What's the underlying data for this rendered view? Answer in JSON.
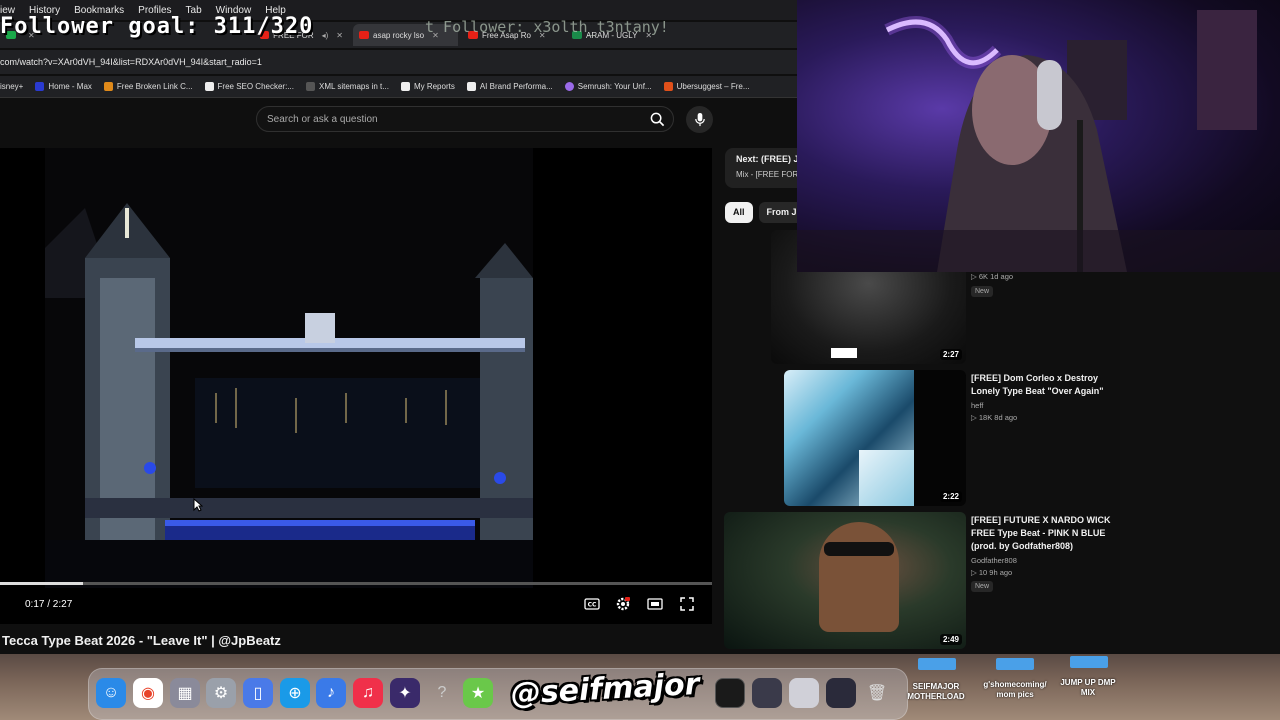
{
  "overlay": {
    "follower_goal": "Follower goal: 311/320",
    "ticker": "t Follower: x3olth_t3ntany!"
  },
  "menubar": {
    "items": [
      "iew",
      "History",
      "Bookmarks",
      "Profiles",
      "Tab",
      "Window",
      "Help"
    ]
  },
  "tabs": [
    {
      "label": "",
      "icon": "youtube-icon",
      "active": false
    },
    {
      "label": "FREE FOR",
      "icon": "youtube-icon",
      "active": false
    },
    {
      "label": "asap rocky lso",
      "icon": "youtube-icon",
      "active": true
    },
    {
      "label": "Free Asap Ro",
      "icon": "youtube-icon",
      "active": false
    },
    {
      "label": "ARAM - UGLY",
      "icon": "game-icon",
      "active": false
    }
  ],
  "browser": {
    "url": "com/watch?v=XAr0dVH_94I&list=RDXAr0dVH_94I&start_radio=1"
  },
  "bookmarks": [
    {
      "label": "isney+",
      "color": "#1a3aa0"
    },
    {
      "label": "Home - Max",
      "color": "#2a3ad0"
    },
    {
      "label": "Free Broken Link C...",
      "color": "#e08a1a"
    },
    {
      "label": "Free SEO Checker:...",
      "color": "#eeeeee"
    },
    {
      "label": "XML sitemaps in t...",
      "color": "#4a4a4a"
    },
    {
      "label": "My Reports",
      "color": "#eeeeee"
    },
    {
      "label": "AI Brand Performa...",
      "color": "#eeeeee"
    },
    {
      "label": "Semrush: Your Unf...",
      "color": "#9a6ae8"
    },
    {
      "label": "Ubersuggest – Fre...",
      "color": "#e0501a"
    }
  ],
  "search": {
    "placeholder": "Search or ask a question"
  },
  "player": {
    "time": "0:17 / 2:27",
    "progress": 0.116,
    "title": "Tecca Type Beat 2026 - \"Leave It\" | @JpBeatz"
  },
  "up_next": {
    "title": "Next: (FREE) J",
    "subtitle": "Mix - [FREE FOR"
  },
  "chips": [
    "All",
    "From Jp"
  ],
  "recommendations": [
    {
      "title": "",
      "channel": "",
      "meta": "6K  1d ago",
      "badge": "New",
      "duration": "2:27"
    },
    {
      "title": "[FREE] Dom Corleo x Destroy Lonely Type Beat \"Over Again\"",
      "channel": "heff",
      "meta": "18K  8d ago",
      "badge": "",
      "duration": "2:22"
    },
    {
      "title": "[FREE] FUTURE X NARDO WICK FREE Type Beat - PINK N BLUE (prod. by Godfather808)",
      "channel": "Godfather808",
      "meta": "10  9h ago",
      "badge": "New",
      "duration": "2:49"
    }
  ],
  "desktop": {
    "logo_text": "@seifmajor",
    "folders": [
      {
        "label": "SEIFMAJOR MOTHERLOAD"
      },
      {
        "label": "g'shomecoming/ mom pics"
      },
      {
        "label": "JUMP UP DMP MIX"
      }
    ]
  }
}
